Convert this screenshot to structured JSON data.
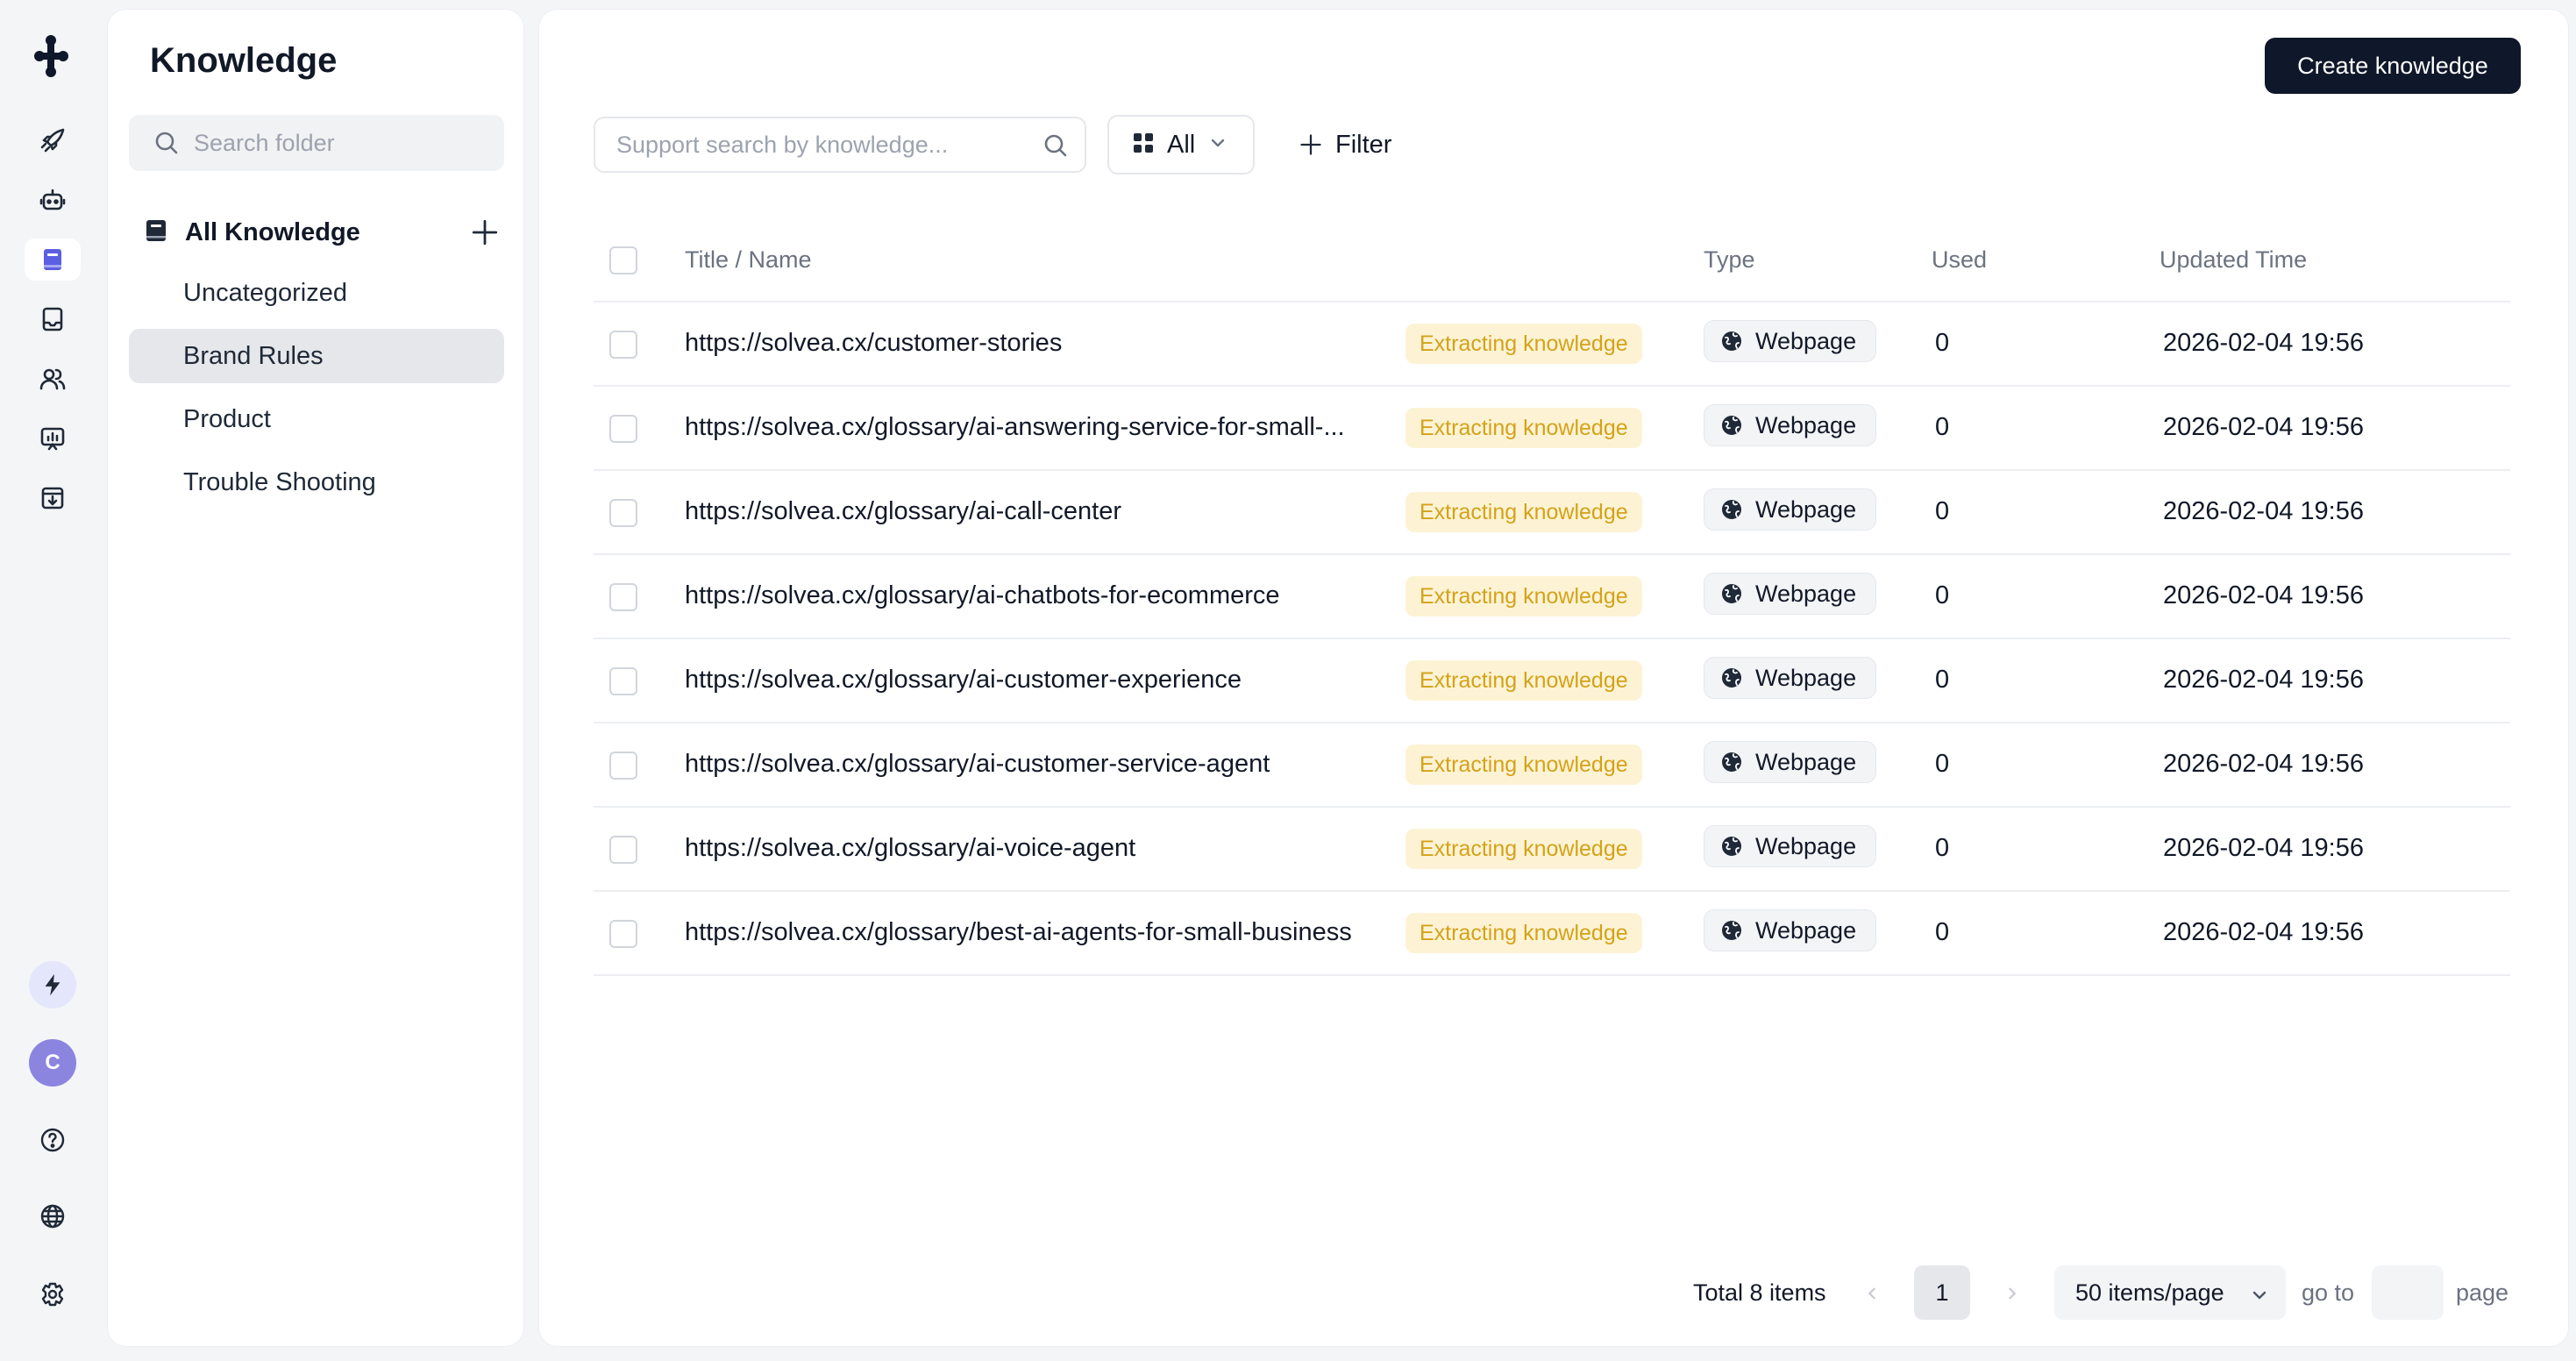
{
  "sidebar": {
    "nav_items": [
      {
        "name": "launch",
        "icon": "rocket-icon"
      },
      {
        "name": "agents",
        "icon": "robot-icon"
      },
      {
        "name": "knowledge",
        "icon": "book-icon",
        "active": true
      },
      {
        "name": "inbox",
        "icon": "inbox-icon"
      },
      {
        "name": "users",
        "icon": "users-icon"
      },
      {
        "name": "analytics",
        "icon": "chart-board-icon"
      },
      {
        "name": "import",
        "icon": "download-box-icon"
      }
    ],
    "avatar_initial": "C"
  },
  "folders": {
    "title": "Knowledge",
    "search_placeholder": "Search folder",
    "root_label": "All Knowledge",
    "items": [
      "Uncategorized",
      "Brand Rules",
      "Product",
      "Trouble Shooting"
    ],
    "active_item": "Brand Rules"
  },
  "toolbar": {
    "create_label": "Create knowledge",
    "search_placeholder": "Support search by knowledge...",
    "type_select": "All",
    "filter_label": "Filter"
  },
  "table": {
    "headers": {
      "title": "Title / Name",
      "type": "Type",
      "used": "Used",
      "updated": "Updated Time"
    },
    "rows": [
      {
        "title": "https://solvea.cx/customer-stories",
        "status": "Extracting knowledge",
        "type": "Webpage",
        "used": "0",
        "updated": "2026-02-04 19:56"
      },
      {
        "title": "https://solvea.cx/glossary/ai-answering-service-for-small-...",
        "status": "Extracting knowledge",
        "type": "Webpage",
        "used": "0",
        "updated": "2026-02-04 19:56"
      },
      {
        "title": "https://solvea.cx/glossary/ai-call-center",
        "status": "Extracting knowledge",
        "type": "Webpage",
        "used": "0",
        "updated": "2026-02-04 19:56"
      },
      {
        "title": "https://solvea.cx/glossary/ai-chatbots-for-ecommerce",
        "status": "Extracting knowledge",
        "type": "Webpage",
        "used": "0",
        "updated": "2026-02-04 19:56"
      },
      {
        "title": "https://solvea.cx/glossary/ai-customer-experience",
        "status": "Extracting knowledge",
        "type": "Webpage",
        "used": "0",
        "updated": "2026-02-04 19:56"
      },
      {
        "title": "https://solvea.cx/glossary/ai-customer-service-agent",
        "status": "Extracting knowledge",
        "type": "Webpage",
        "used": "0",
        "updated": "2026-02-04 19:56"
      },
      {
        "title": "https://solvea.cx/glossary/ai-voice-agent",
        "status": "Extracting knowledge",
        "type": "Webpage",
        "used": "0",
        "updated": "2026-02-04 19:56"
      },
      {
        "title": "https://solvea.cx/glossary/best-ai-agents-for-small-business",
        "status": "Extracting knowledge",
        "type": "Webpage",
        "used": "0",
        "updated": "2026-02-04 19:56"
      }
    ]
  },
  "pagination": {
    "total": "Total 8 items",
    "current_page": "1",
    "per_page": "50 items/page",
    "goto_label": "go to",
    "page_label": "page"
  },
  "colors": {
    "accent": "#5b5fe0",
    "primary_button": "#0f172a",
    "status_bg": "#fdf3d4",
    "status_text": "#d4a21a"
  }
}
